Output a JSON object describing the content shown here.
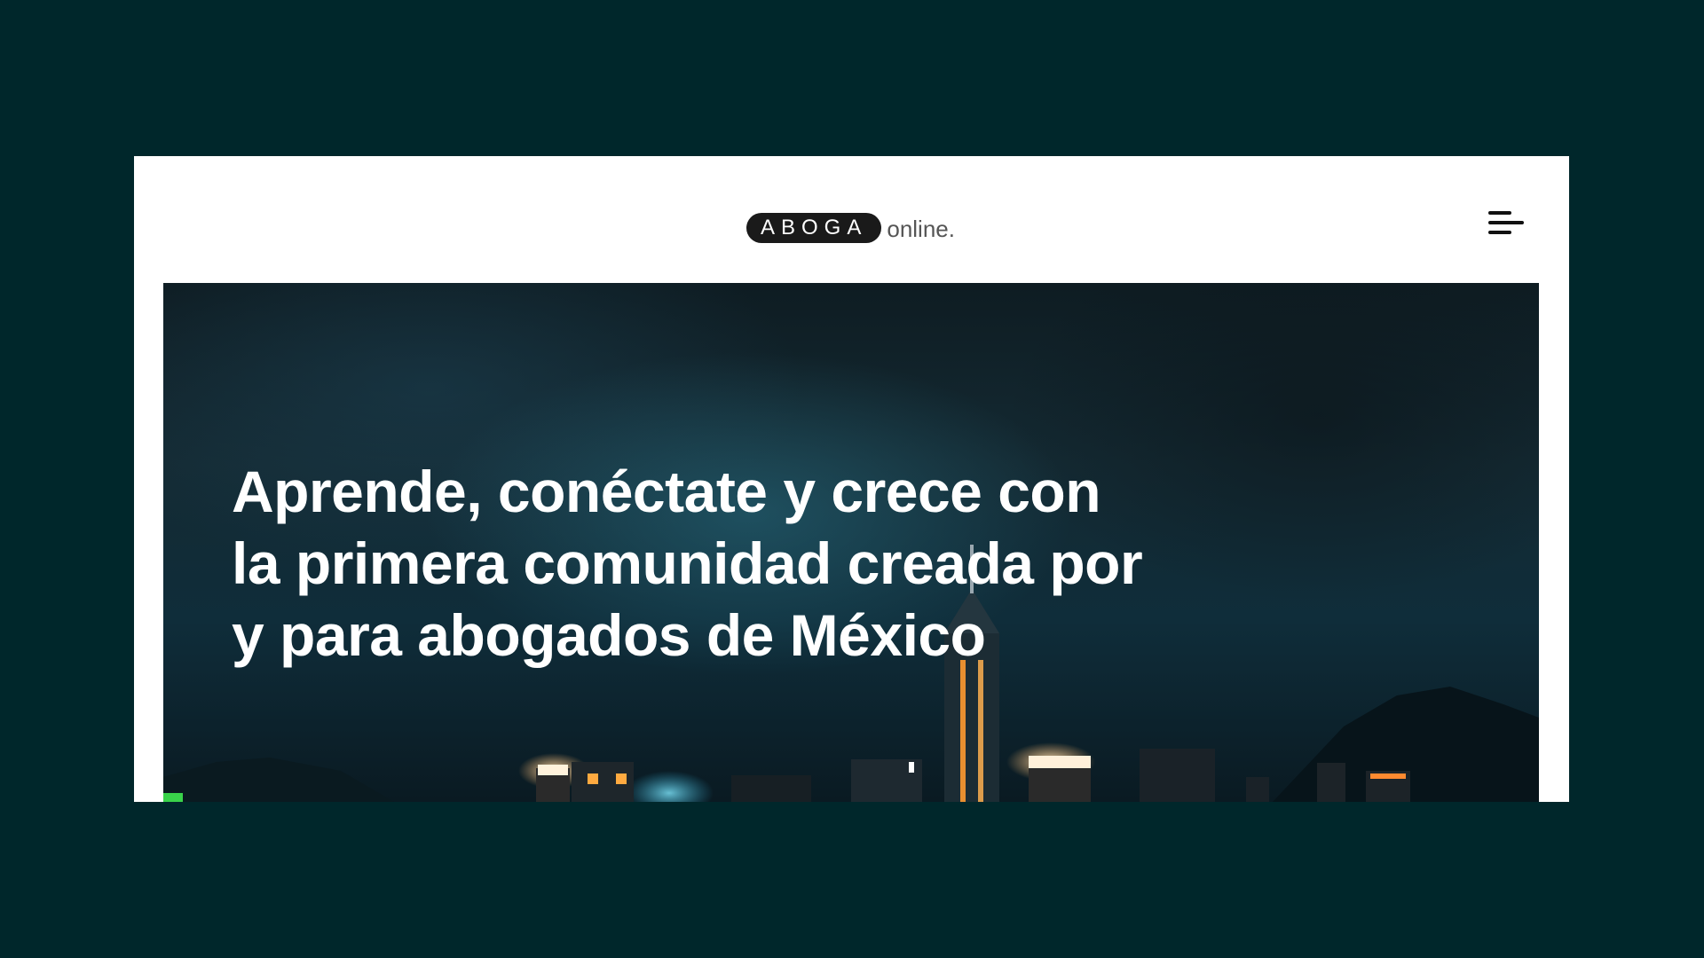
{
  "header": {
    "logo": {
      "pill_text": "ABOGA",
      "suffix_text": "online."
    },
    "menu_icon": "hamburger-menu-icon"
  },
  "hero": {
    "title": "Aprende, conéctate y crece con la primera comunidad creada por y para abogados de México",
    "background_image": "night-city-skyline"
  },
  "colors": {
    "page_background": "#00272b",
    "frame_background": "#ffffff",
    "logo_pill": "#1a1a1a",
    "hero_text": "#ffffff"
  }
}
